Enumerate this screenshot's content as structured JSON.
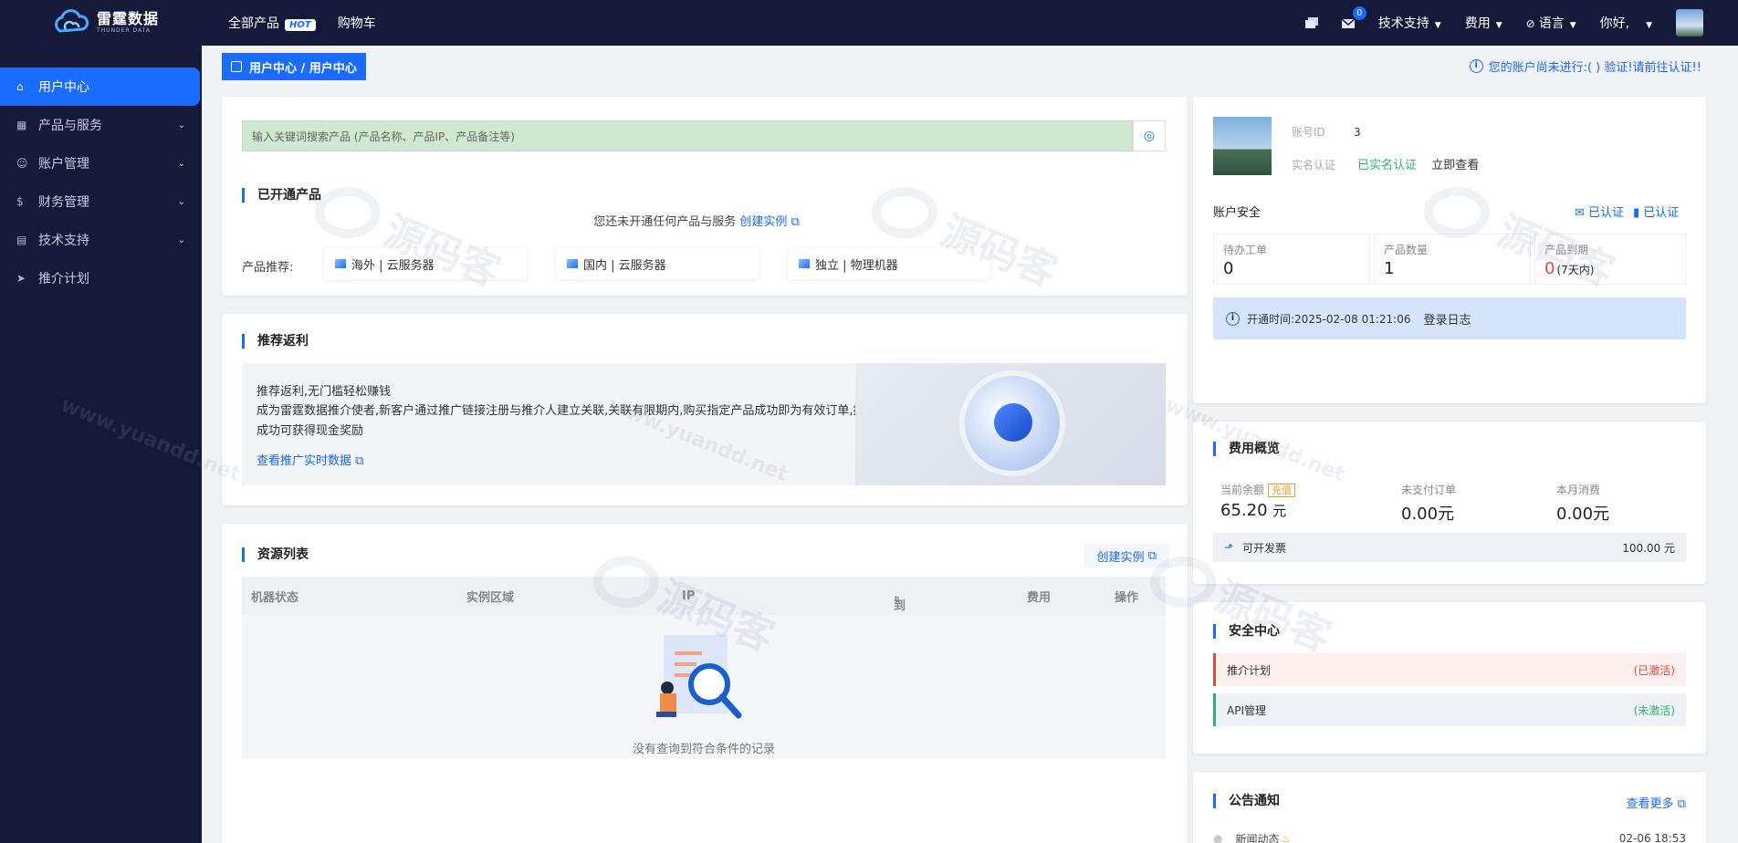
{
  "brand": {
    "name_cn": "雷霆数据",
    "name_en": "THUNDER DATA"
  },
  "topnav": {
    "all_products": "全部产品",
    "hot_badge": "HOT",
    "cart": "购物车"
  },
  "topright": {
    "mail_count": "0",
    "tech_support": "技术支持",
    "fees": "费用",
    "language": "语言",
    "greeting": "你好,"
  },
  "sidebar": {
    "items": [
      {
        "label": "用户中心",
        "icon": "home-icon"
      },
      {
        "label": "产品与服务",
        "icon": "grid-icon"
      },
      {
        "label": "账户管理",
        "icon": "user-icon"
      },
      {
        "label": "财务管理",
        "icon": "finance-icon"
      },
      {
        "label": "技术支持",
        "icon": "support-icon"
      },
      {
        "label": "推介计划",
        "icon": "send-icon"
      }
    ]
  },
  "breadcrumb": "用户中心 / 用户中心",
  "notice": "您的账户尚未进行:( ) 验证!请前往认证!!",
  "products": {
    "search_placeholder": "输入关键词搜索产品 (产品名称、产品IP、产品备注等)",
    "title": "已开通产品",
    "empty_text": "您还未开通任何产品与服务",
    "create_link": "创建实例",
    "rec_label": "产品推荐:",
    "recommendations": [
      "海外 | 云服务器",
      "国内 | 云服务器",
      "独立 | 物理机器"
    ]
  },
  "referral": {
    "title": "推荐返利",
    "headline": "推荐返利,无门槛轻松赚钱",
    "description": "成为雷霆数据推介使者,新客户通过推广链接注册与推介人建立关联,关联有限期内,购买指定产品成功即为有效订单,推介成功可获得现金奖励",
    "link": "查看推广实时数据"
  },
  "resources": {
    "title": "资源列表",
    "create_button": "创建实例",
    "columns": [
      "机器状态",
      "实例区域",
      "IP",
      "到期时间",
      "费用",
      "操作"
    ],
    "empty_text": "没有查询到符合条件的记录"
  },
  "account": {
    "id_label": "账号ID",
    "id_value": "3",
    "realname_label": "实名认证",
    "realname_status": "已实名认证",
    "view_now": "立即查看",
    "security_title": "账户安全",
    "verified_email": "已认证",
    "verified_phone": "已认证",
    "stats": [
      {
        "label": "待办工单",
        "value": "0"
      },
      {
        "label": "产品数量",
        "value": "1"
      },
      {
        "label": "产品到期",
        "value": "0",
        "suffix": "(7天内)"
      }
    ],
    "open_time": "开通时间:2025-02-08 01:21:06",
    "login_log": "登录日志"
  },
  "fees": {
    "title": "费用概览",
    "balance_label": "当前余额",
    "recharge": "充值",
    "balance": "65.20",
    "balance_unit": "元",
    "unpaid_label": "未支付订单",
    "unpaid": "0.00元",
    "month_label": "本月消费",
    "month": "0.00元",
    "invoice_label": "可开发票",
    "invoice_value": "100.00 元"
  },
  "security": {
    "title": "安全中心",
    "rows": [
      {
        "label": "推介计划",
        "status": "(已激活)"
      },
      {
        "label": "API管理",
        "status": "(未激活)"
      }
    ]
  },
  "announcements": {
    "title": "公告通知",
    "more": "查看更多",
    "items": [
      {
        "label": "新闻动态",
        "date": "02-06 18:53"
      }
    ]
  },
  "watermark": {
    "text": "源码客",
    "url": "www.yuandd.net"
  },
  "colors": {
    "primary": "#1a6cff",
    "nav_bg": "#161a3a",
    "success": "#2fb46d",
    "danger": "#e0483f",
    "warning": "#e8a030"
  }
}
